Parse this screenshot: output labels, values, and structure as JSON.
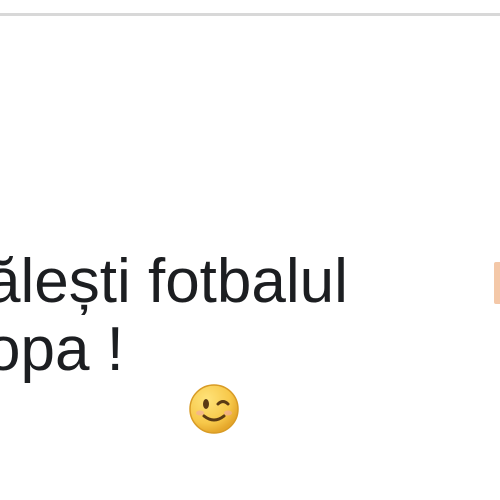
{
  "post": {
    "line1": "ălești fotbalul",
    "line2": "opa !"
  },
  "icons": {
    "emoji": "winking-face-icon",
    "partial_flag": "flag-icon"
  },
  "colors": {
    "text": "#1c1e21",
    "divider": "#d8d8d8",
    "emoji_face": "#f7c84a"
  }
}
